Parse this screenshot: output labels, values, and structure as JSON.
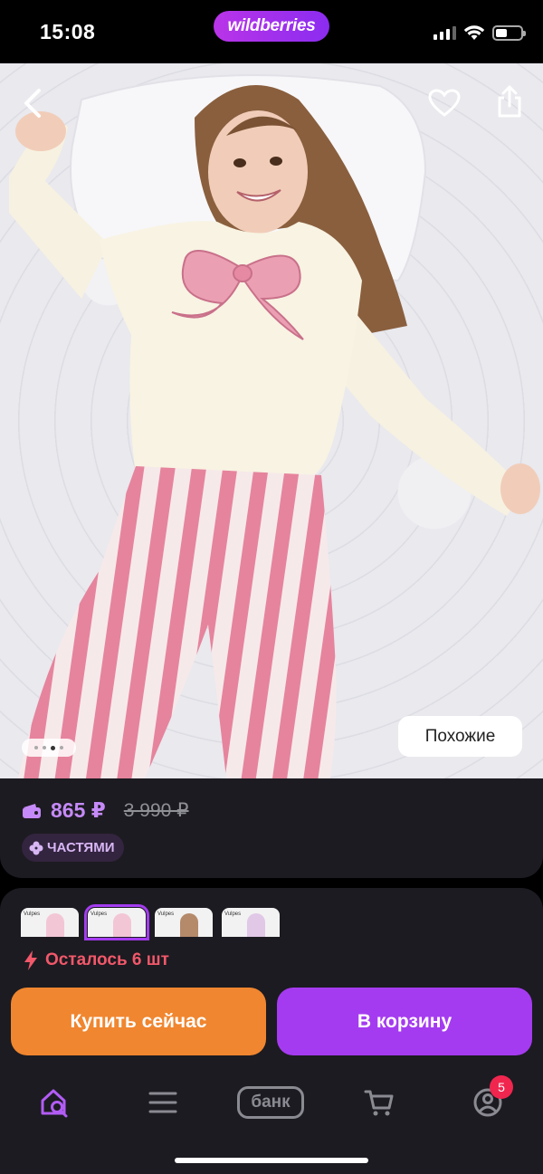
{
  "status_bar": {
    "time": "15:08",
    "brand": "wildberries",
    "icons": [
      "signal-icon",
      "wifi-icon",
      "battery-icon"
    ],
    "battery_level": 0.45
  },
  "hero": {
    "image_indicator_dots": 4,
    "active_dot": 3,
    "similar_label": "Похожие",
    "icons": [
      "back-arrow-icon",
      "heart-icon",
      "share-icon"
    ]
  },
  "price": {
    "current": "865 ₽",
    "old": "3 990 ₽",
    "installments_label": "ЧАСТЯМИ",
    "accent_color": "#c58af7"
  },
  "variants": {
    "count_visible": 4,
    "selected_index": 1,
    "thumb_caption": "Vulpes"
  },
  "stock": {
    "label": "Осталось 6 шт",
    "color": "#f2586a"
  },
  "actions": {
    "buy_now": "Купить сейчас",
    "add_to_cart": "В корзину",
    "buy_color": "#f0862f",
    "cart_color": "#a53bf0"
  },
  "tabbar": {
    "items": [
      "home-search-icon",
      "catalog-icon",
      "bank",
      "cart-icon",
      "profile-icon"
    ],
    "bank_label": "банк",
    "profile_badge": "5",
    "active_color": "#b25cf5"
  }
}
